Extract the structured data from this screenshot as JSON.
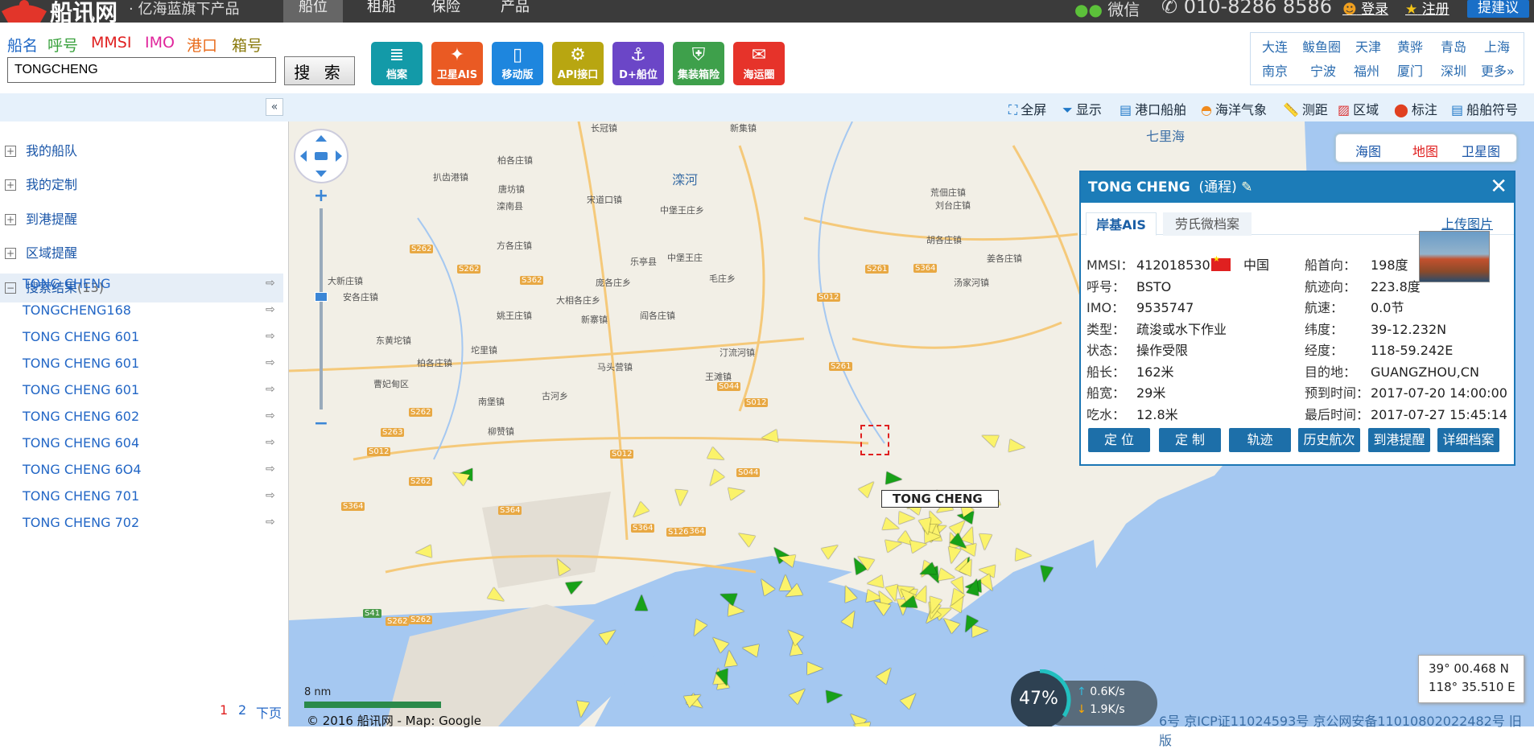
{
  "top": {
    "brand": "船讯网",
    "slogan": "· 亿海蓝旗下产品",
    "nav": [
      "船位",
      "租船",
      "保险",
      "产品"
    ],
    "wechat": "微信",
    "hotline": "010-8286 8586",
    "login": "登录",
    "register": "注册",
    "suggest": "提建议"
  },
  "search": {
    "types": [
      "船名",
      "呼号",
      "MMSI",
      "IMO",
      "港口",
      "箱号"
    ],
    "type_colors": [
      "#1f68c6",
      "#39a13d",
      "#e02020",
      "#e0259c",
      "#e86b1b",
      "#8a7a0d"
    ],
    "value": "TONGCHENG",
    "button": "搜 索"
  },
  "tools": [
    {
      "label": "档案",
      "color": "#139aa8",
      "icon": "≣"
    },
    {
      "label": "卫星AIS",
      "color": "#ea5a23",
      "icon": "✦"
    },
    {
      "label": "移动版",
      "color": "#1e86de",
      "icon": "▯"
    },
    {
      "label": "API接口",
      "color": "#b8a611",
      "icon": "⚙"
    },
    {
      "label": "D+船位",
      "color": "#6b46c7",
      "icon": "⚓"
    },
    {
      "label": "集装箱险",
      "color": "#3ea04b",
      "icon": "⛨"
    },
    {
      "label": "海运圈",
      "color": "#e6332a",
      "icon": "✉"
    }
  ],
  "cities": [
    "大连",
    "鲅鱼圈",
    "天津",
    "黄骅",
    "青岛",
    "上海",
    "南京",
    "宁波",
    "福州",
    "厦门",
    "深圳",
    "更多»"
  ],
  "toolbar": [
    "全屏",
    "显示",
    "港口船舶",
    "海洋气象",
    "测距",
    "区域",
    "标注",
    "船舶符号"
  ],
  "sidebar": {
    "tree": [
      "我的船队",
      "我的定制",
      "到港提醒",
      "区域提醒",
      "搜索结果"
    ],
    "result_count": "(13)",
    "results": [
      "TONG CHENG",
      "TONGCHENG168",
      "TONG CHENG 601",
      "TONG CHENG 601",
      "TONG CHENG 601",
      "TONG CHENG 602",
      "TONG CHENG 604",
      "TONG CHENG 6O4",
      "TONG CHENG 701",
      "TONG CHENG 702"
    ],
    "pages": [
      "1",
      "2",
      "下页"
    ]
  },
  "maptype": [
    "海图",
    "地图",
    "卫星图"
  ],
  "info": {
    "title": "TONG CHENG",
    "status": "(通程)",
    "tabs": [
      "岸基AIS",
      "劳氏微档案"
    ],
    "upload": "上传图片",
    "left": [
      [
        "MMSI：",
        "412018530"
      ],
      [
        "呼号：",
        "BSTO"
      ],
      [
        "IMO：",
        "9535747"
      ],
      [
        "类型：",
        "疏浚或水下作业"
      ],
      [
        "状态：",
        "操作受限"
      ],
      [
        "船长：",
        "162米"
      ],
      [
        "船宽：",
        "29米"
      ],
      [
        "吃水：",
        "12.8米"
      ]
    ],
    "flag_country": "中国",
    "right": [
      [
        "船首向：",
        "198度"
      ],
      [
        "航迹向：",
        "223.8度"
      ],
      [
        "航速：",
        "0.0节"
      ],
      [
        "纬度：",
        "39-12.232N"
      ],
      [
        "经度：",
        "118-59.242E"
      ],
      [
        "目的地：",
        "GUANGZHOU,CN"
      ],
      [
        "预到时间：",
        "2017-07-20 14:00:00"
      ],
      [
        "最后时间：",
        "2017-07-27 15:45:14"
      ]
    ],
    "buttons": [
      "定 位",
      "定 制",
      "轨迹",
      "历史航次",
      "到港提醒",
      "详细档案"
    ]
  },
  "map": {
    "places": [
      "长冠镇",
      "新集镇",
      "柏各庄镇",
      "扒齿港镇",
      "唐坊镇",
      "滦南县",
      "宋道口镇",
      "中堡王庄乡",
      "滦河",
      "荒佃庄镇",
      "刘台庄镇",
      "胡各庄镇",
      "方各庄镇",
      "中堡王庄",
      "乐亭县",
      "毛庄乡",
      "汤家河镇",
      "庞各庄乡",
      "姜各庄镇",
      "阎各庄镇",
      "大新庄镇",
      "安各庄镇",
      "大相各庄乡",
      "姚王庄镇",
      "新寨镇",
      "东黄坨镇",
      "坨里镇",
      "汀流河镇",
      "马头营镇",
      "柏各庄镇",
      "南堡镇",
      "古河乡",
      "王滩镇",
      "曹妃甸区",
      "柳赞镇",
      "七里海"
    ],
    "roads": [
      "S262",
      "S262",
      "S364",
      "S261",
      "S362",
      "S012",
      "S261",
      "S044",
      "S012",
      "S262",
      "S263",
      "S012",
      "S012",
      "S262",
      "S044",
      "S364",
      "S364",
      "S364",
      "S364",
      "S126",
      "S41",
      "S262",
      "S262"
    ],
    "ship_label": "TONG CHENG",
    "scale": "8 nm",
    "copyright": "© 2016 船讯网 - Map: Google",
    "icp": "6号 京ICP证11024593号 京公网安备11010802022482号 旧版"
  },
  "coords": {
    "lat": "39° 00.468 N",
    "lon": "118° 35.510 E"
  },
  "speed": {
    "percent": "47%",
    "up": "0.6K/s",
    "down": "1.9K/s"
  }
}
